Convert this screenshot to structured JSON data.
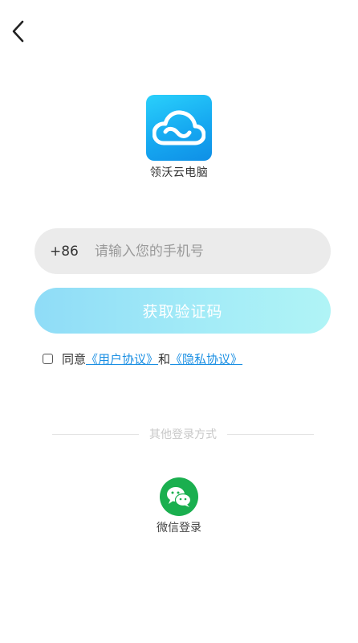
{
  "nav": {
    "back_icon": "chevron-left-icon"
  },
  "app": {
    "logo_icon": "cloud-logo-icon",
    "name": "领沃云电脑"
  },
  "login_form": {
    "country_code": "+86",
    "phone_placeholder": "请输入您的手机号",
    "phone_value": "",
    "get_code_label": "获取验证码",
    "button_gradient": [
      "#8fdcf7",
      "#b0f4f6"
    ]
  },
  "agreement": {
    "checked": false,
    "prefix": "同意",
    "user_agreement": "《用户协议》",
    "conjunction": "和",
    "privacy_agreement": "《隐私协议》",
    "link_color": "#1a8fe3"
  },
  "other_login": {
    "divider_text": "其他登录方式",
    "wechat_icon": "wechat-icon",
    "wechat_label": "微信登录",
    "wechat_color": "#1aaf4f"
  }
}
